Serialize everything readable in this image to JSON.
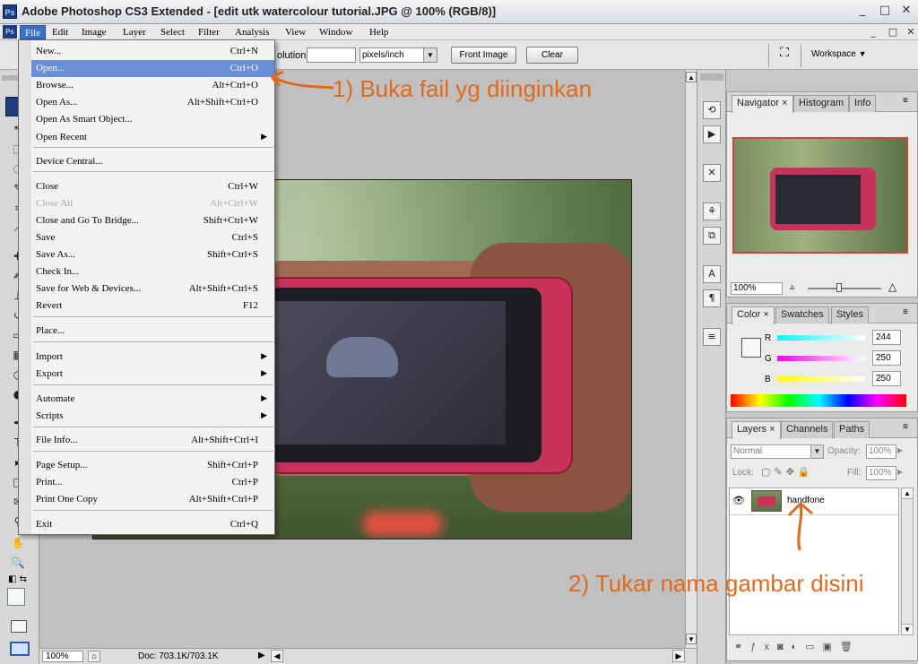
{
  "window": {
    "title": "Adobe Photoshop CS3 Extended - [edit utk watercolour tutorial.JPG @ 100% (RGB/8)]",
    "app_icon": "Ps",
    "controls": [
      "_",
      "□",
      "✕"
    ]
  },
  "menubar": {
    "items": [
      "File",
      "Edit",
      "Image",
      "Layer",
      "Select",
      "Filter",
      "Analysis",
      "View",
      "Window",
      "Help"
    ],
    "active": "File"
  },
  "options": {
    "resolution_label": "olution:",
    "resolution_value": "",
    "units": "pixels/inch",
    "front_image": "Front Image",
    "clear": "Clear",
    "workspace": "Workspace"
  },
  "file_menu": [
    {
      "label": "New...",
      "shortcut": "Ctrl+N"
    },
    {
      "label": "Open...",
      "shortcut": "Ctrl+O",
      "highlighted": true
    },
    {
      "label": "Browse...",
      "shortcut": "Alt+Ctrl+O"
    },
    {
      "label": "Open As...",
      "shortcut": "Alt+Shift+Ctrl+O"
    },
    {
      "label": "Open As Smart Object...",
      "shortcut": ""
    },
    {
      "label": "Open Recent",
      "shortcut": "",
      "submenu": true
    },
    {
      "separator": true
    },
    {
      "label": "Device Central...",
      "shortcut": ""
    },
    {
      "separator": true
    },
    {
      "label": "Close",
      "shortcut": "Ctrl+W"
    },
    {
      "label": "Close All",
      "shortcut": "Alt+Ctrl+W",
      "disabled": true
    },
    {
      "label": "Close and Go To Bridge...",
      "shortcut": "Shift+Ctrl+W"
    },
    {
      "label": "Save",
      "shortcut": "Ctrl+S"
    },
    {
      "label": "Save As...",
      "shortcut": "Shift+Ctrl+S"
    },
    {
      "label": "Check In...",
      "shortcut": ""
    },
    {
      "label": "Save for Web & Devices...",
      "shortcut": "Alt+Shift+Ctrl+S"
    },
    {
      "label": "Revert",
      "shortcut": "F12"
    },
    {
      "separator": true
    },
    {
      "label": "Place...",
      "shortcut": ""
    },
    {
      "separator": true
    },
    {
      "label": "Import",
      "shortcut": "",
      "submenu": true
    },
    {
      "label": "Export",
      "shortcut": "",
      "submenu": true
    },
    {
      "separator": true
    },
    {
      "label": "Automate",
      "shortcut": "",
      "submenu": true
    },
    {
      "label": "Scripts",
      "shortcut": "",
      "submenu": true
    },
    {
      "separator": true
    },
    {
      "label": "File Info...",
      "shortcut": "Alt+Shift+Ctrl+I"
    },
    {
      "separator": true
    },
    {
      "label": "Page Setup...",
      "shortcut": "Shift+Ctrl+P"
    },
    {
      "label": "Print...",
      "shortcut": "Ctrl+P"
    },
    {
      "label": "Print One Copy",
      "shortcut": "Alt+Shift+Ctrl+P"
    },
    {
      "separator": true
    },
    {
      "label": "Exit",
      "shortcut": "Ctrl+Q"
    }
  ],
  "status": {
    "zoom": "100%",
    "doc": "Doc: 703.1K/703.1K"
  },
  "navigator": {
    "tabs": [
      "Navigator",
      "Histogram",
      "Info"
    ],
    "zoom": "100%"
  },
  "color": {
    "tabs": [
      "Color",
      "Swatches",
      "Styles"
    ],
    "r_label": "R",
    "g_label": "G",
    "b_label": "B",
    "r": "244",
    "g": "250",
    "b": "250"
  },
  "layers": {
    "tabs": [
      "Layers",
      "Channels",
      "Paths"
    ],
    "blend_mode": "Normal",
    "opacity_label": "Opacity:",
    "opacity": "100%",
    "lock_label": "Lock:",
    "fill_label": "Fill:",
    "fill": "100%",
    "layer_name": "handfone"
  },
  "annotations": {
    "note1": "1) Buka fail yg diinginkan",
    "note2": "2) Tukar nama gambar disini"
  },
  "colors": {
    "accent": "#3c6fc8",
    "annotation": "#e06a1c"
  }
}
